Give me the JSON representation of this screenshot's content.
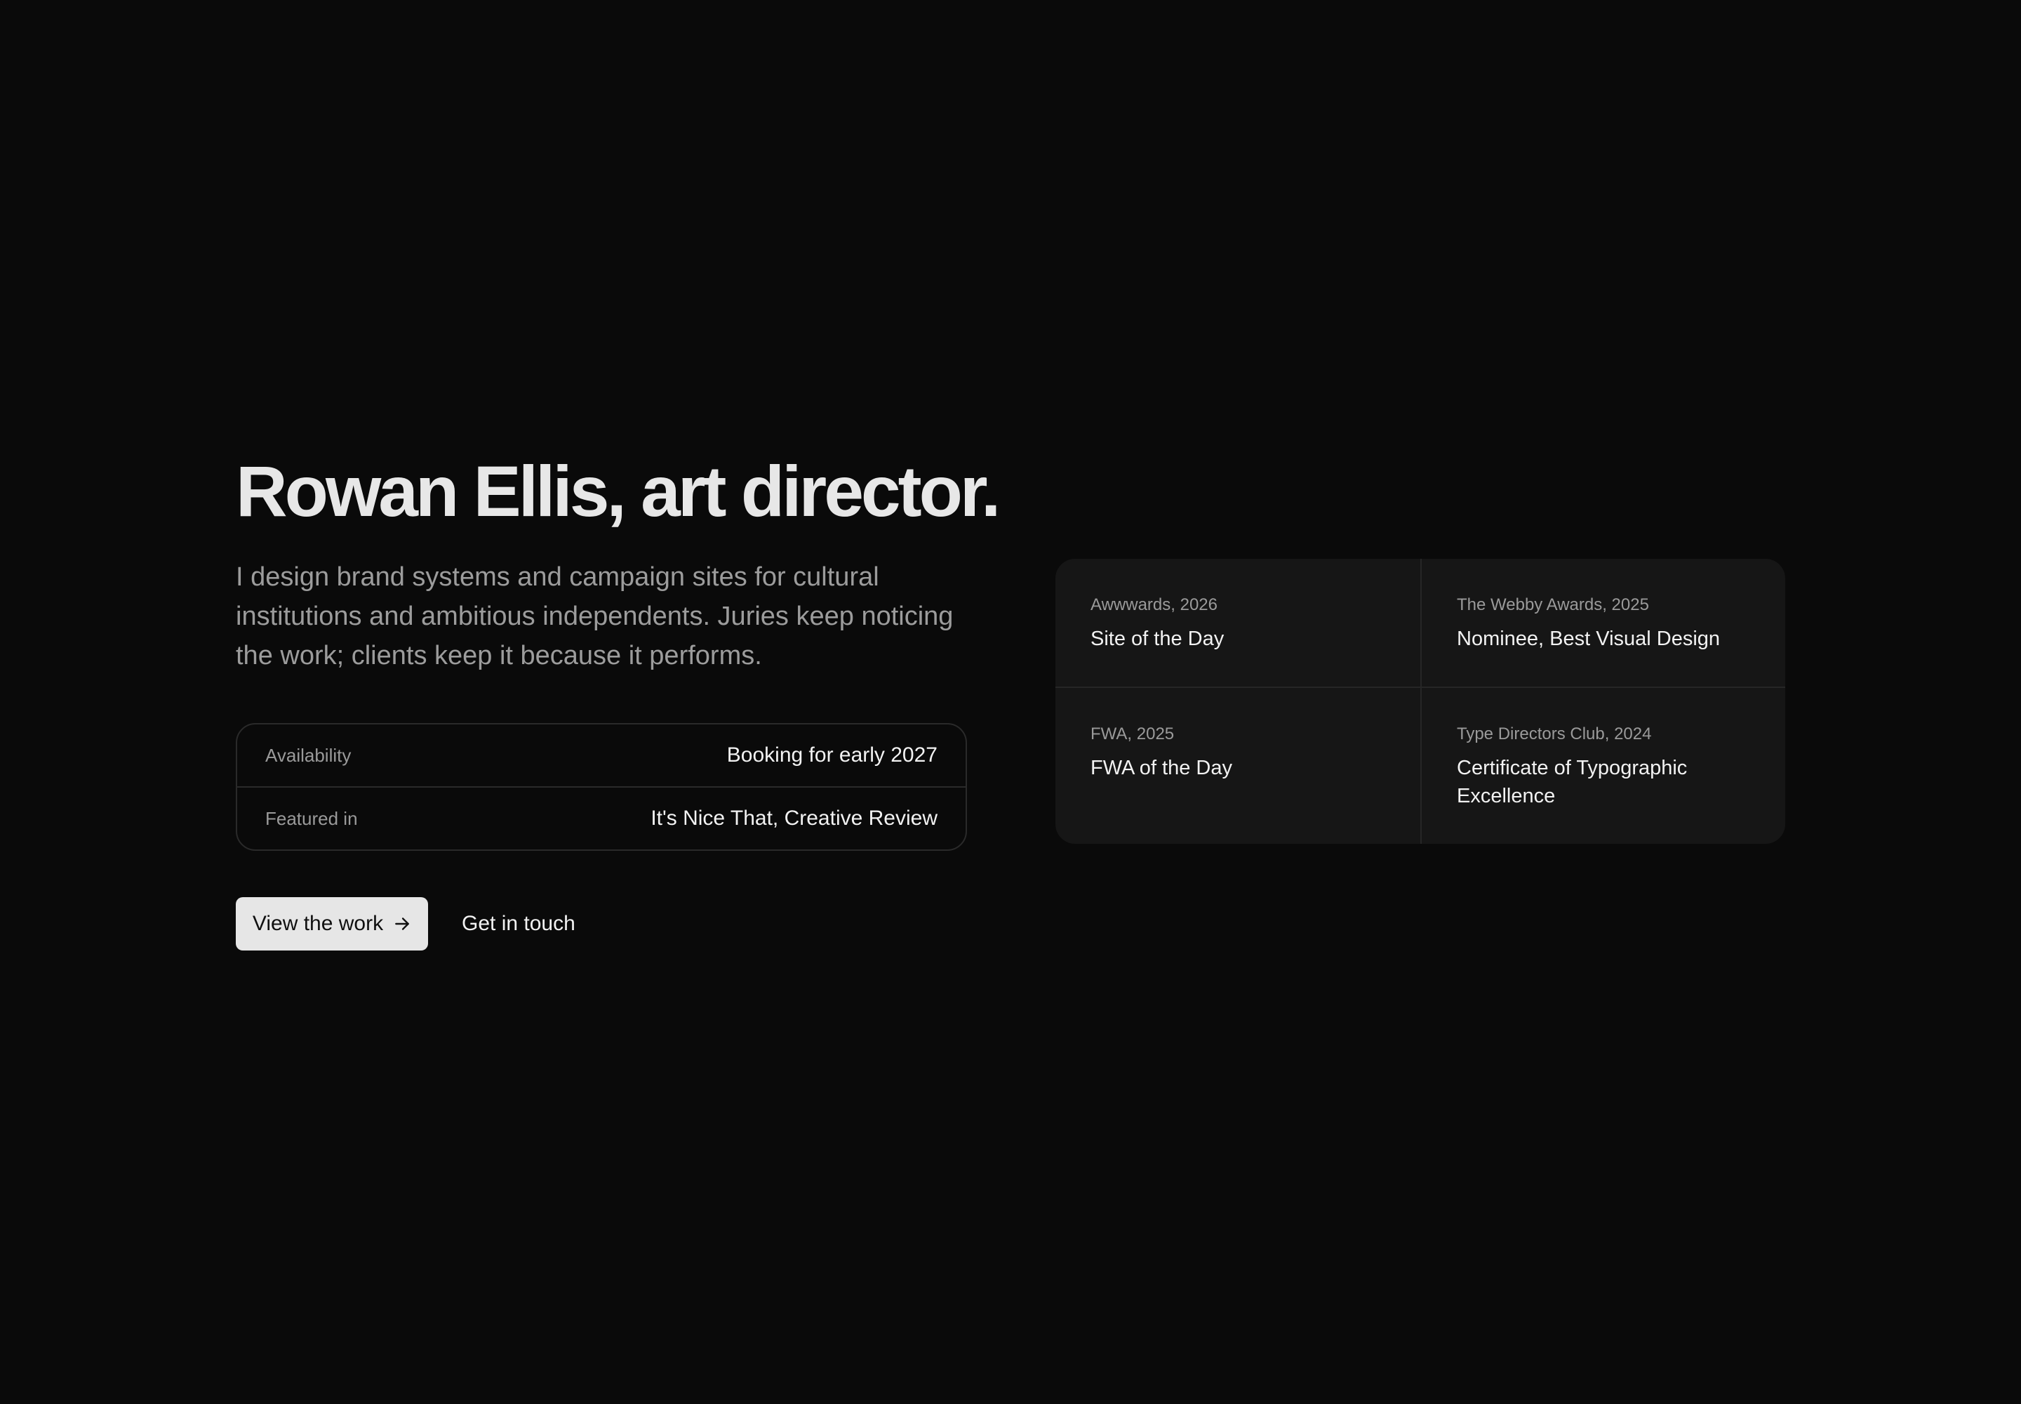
{
  "hero": {
    "title": "Rowan Ellis, art director.",
    "intro": "I design brand systems and campaign sites for cultural institutions and ambitious independents. Juries keep noticing the work; clients keep it because it performs."
  },
  "facts": [
    {
      "label": "Availability",
      "value": "Booking for early 2027"
    },
    {
      "label": "Featured in",
      "value": "It's Nice That, Creative Review"
    }
  ],
  "actions": {
    "primary_label": "View the work",
    "primary_icon": "arrow-right-icon",
    "secondary_label": "Get in touch"
  },
  "awards": [
    {
      "meta": "Awwwards, 2026",
      "title": "Site of the Day"
    },
    {
      "meta": "The Webby Awards, 2025",
      "title": "Nominee, Best Visual Design"
    },
    {
      "meta": "FWA, 2025",
      "title": "FWA of the Day"
    },
    {
      "meta": "Type Directors Club, 2024",
      "title": "Certificate of Typographic Excellence"
    }
  ],
  "colors": {
    "background": "#0a0a0a",
    "panel": "#161616",
    "button": "#e6e6e6",
    "muted_text": "#9c9c9c"
  }
}
